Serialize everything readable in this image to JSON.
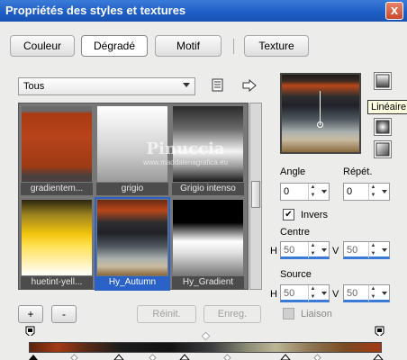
{
  "window": {
    "title": "Propriétés des styles et textures",
    "close_glyph": "x"
  },
  "tabs": [
    {
      "label": "Couleur",
      "active": false
    },
    {
      "label": "Dégradé",
      "active": true
    },
    {
      "label": "Motif",
      "active": false
    },
    {
      "label": "Texture",
      "active": false
    }
  ],
  "category_select": {
    "value": "Tous"
  },
  "thumbnails": [
    {
      "label": "gradientem...",
      "selected": false
    },
    {
      "label": "grigio",
      "selected": false
    },
    {
      "label": "Grigio intenso",
      "selected": false
    },
    {
      "label": "huetint-yell...",
      "selected": false
    },
    {
      "label": "Hy_Autumn",
      "selected": true
    },
    {
      "label": "Hy_Gradient",
      "selected": false
    }
  ],
  "watermark": {
    "line1": "Pinuccia",
    "line2": "www.maddalenagrafica.eu"
  },
  "tooltip": "Linéaire",
  "angle": {
    "label": "Angle",
    "value": "0"
  },
  "repeat": {
    "label": "Répét.",
    "value": "0"
  },
  "invert": {
    "label": "Invers",
    "checked": true
  },
  "center": {
    "label": "Centre",
    "h_label": "H",
    "h_value": "50",
    "v_label": "V",
    "v_value": "50"
  },
  "source": {
    "label": "Source",
    "h_label": "H",
    "h_value": "50",
    "v_label": "V",
    "v_value": "50"
  },
  "link": {
    "label": "Liaison",
    "checked": false
  },
  "buttons": {
    "add": "+",
    "remove": "-",
    "reset": "Réinit.",
    "save": "Enreg."
  }
}
